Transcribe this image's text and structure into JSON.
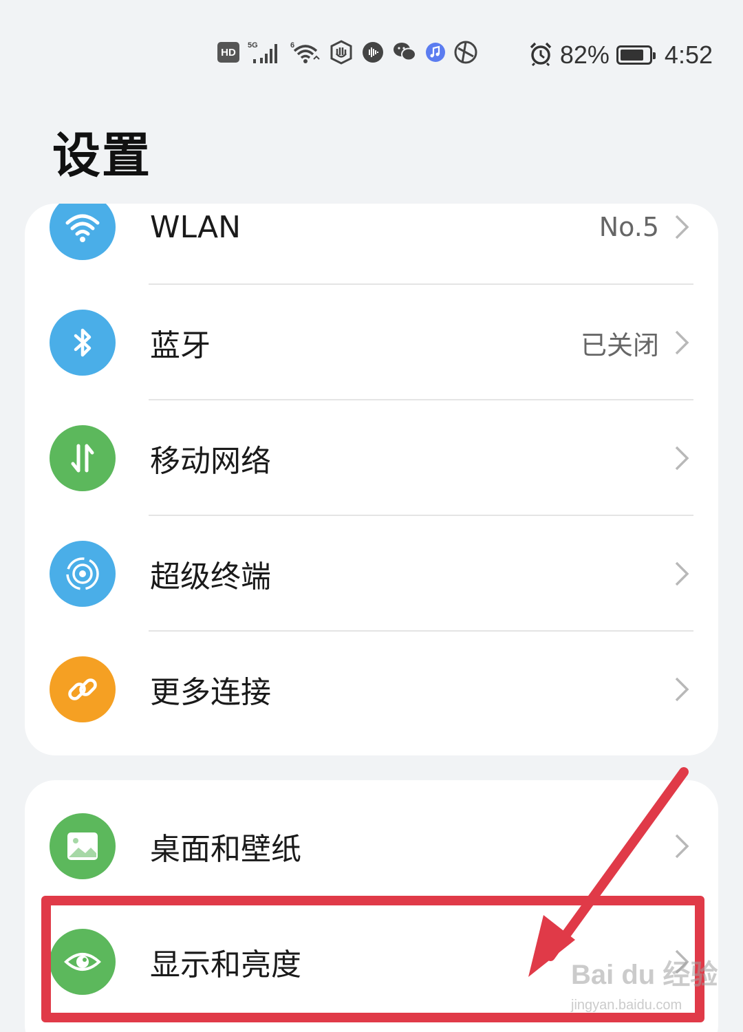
{
  "status_bar": {
    "left_icons": [
      "hd-icon",
      "5g-signal-icon",
      "wifi-6-icon",
      "hand-shield-icon",
      "voice-assistant-icon",
      "wechat-icon",
      "music-app-icon",
      "browser-icon"
    ],
    "hd_label": "HD",
    "battery_percent": "82%",
    "battery_level": 0.82,
    "time": "4:52"
  },
  "page": {
    "title": "设置"
  },
  "groups": [
    {
      "items": [
        {
          "label": "WLAN",
          "value": "No.5",
          "icon": "wifi-icon",
          "color": "#4aaee8"
        },
        {
          "label": "蓝牙",
          "value": "已关闭",
          "icon": "bluetooth-icon",
          "color": "#4aaee8"
        },
        {
          "label": "移动网络",
          "value": "",
          "icon": "mobile-data-icon",
          "color": "#5cb85c"
        },
        {
          "label": "超级终端",
          "value": "",
          "icon": "super-device-icon",
          "color": "#4aaee8"
        },
        {
          "label": "更多连接",
          "value": "",
          "icon": "link-icon",
          "color": "#f5a023"
        }
      ]
    },
    {
      "items": [
        {
          "label": "桌面和壁纸",
          "value": "",
          "icon": "wallpaper-icon",
          "color": "#5cb85c"
        },
        {
          "label": "显示和亮度",
          "value": "",
          "icon": "eye-icon",
          "color": "#5cb85c"
        }
      ]
    }
  ],
  "annotation": {
    "color": "#e03a48"
  },
  "watermark": {
    "text": "Bai du 经验",
    "sub": "jingyan.baidu.com"
  }
}
